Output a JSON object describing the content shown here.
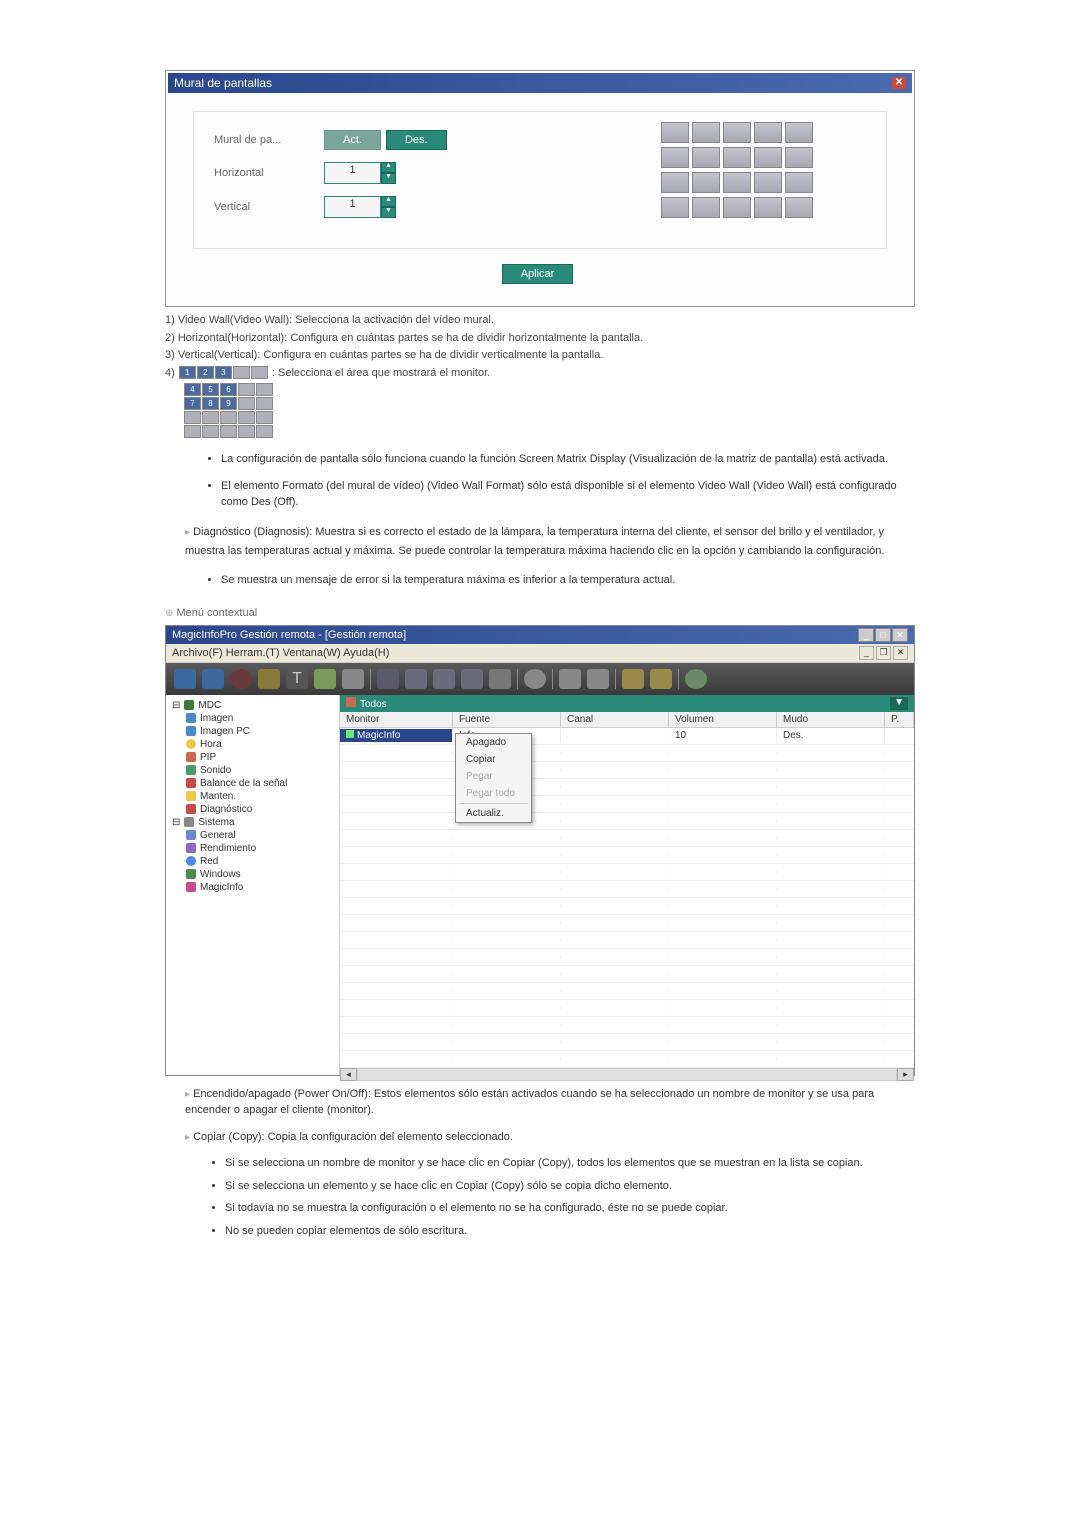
{
  "dialog": {
    "title": "Mural de pantallas",
    "labels": {
      "mural": "Mural de pa...",
      "horizontal": "Horizontal",
      "vertical": "Vertical"
    },
    "buttons": {
      "act": "Act.",
      "des": "Des.",
      "aplicar": "Aplicar"
    },
    "values": {
      "horizontal": "1",
      "vertical": "1"
    }
  },
  "desc": {
    "d1": "1) Video Wall(Video Wall): Selecciona la activación del vídeo mural.",
    "d2": "2) Horizontal(Horizontal): Configura en cuántas partes se ha de dividir horizontalmente la pantalla.",
    "d3": "3) Vertical(Vertical): Configura en cuántas partes se ha de dividir verticalmente la pantalla.",
    "d4_pre": "4) ",
    "d4_post": " : Selecciona el área que mostrará el monitor."
  },
  "bullets1": {
    "b1": "La configuración de pantalla sólo funciona cuando la función Screen Matrix Display (Visualización de la matriz de pantalla) está activada.",
    "b2": "El elemento Formato (del mural de vídeo) (Video Wall Format) sólo está disponible si el elemento Video Wall (Video Wall) está configurado como Des (Off)."
  },
  "diag_para": "Diagnóstico (Diagnosis): Muestra si es correcto el estado de la lámpara, la temperatura interna del cliente, el sensor del brillo y el ventilador, y muestra las temperaturas actual y máxima. Se puede controlar la temperatura máxima haciendo clic en la opción y cambiando la configuración.",
  "diag_bullet": "Se muestra un mensaje de error si la temperatura máxima es inferior a la temperatura actual.",
  "menu_contextual_heading": "Menú contextual",
  "app": {
    "title": "MagicInfoPro Gestión remota - [Gestión remota]",
    "menubar": "Archivo(F)  Herram.(T)  Ventana(W)  Ayuda(H)",
    "tree": {
      "root": "MDC",
      "imagen": "Imagen",
      "imagen_pc": "Imagen PC",
      "hora": "Hora",
      "pip": "PIP",
      "sonido": "Sonido",
      "balance": "Balance de la señal",
      "manten": "Manten.",
      "diagnostico": "Diagnóstico",
      "sistema": "Sistema",
      "general": "General",
      "rendimiento": "Rendimiento",
      "red": "Red",
      "windows": "Windows",
      "magicinfo": "MagicInfo"
    },
    "right_top": "Todos",
    "headers": {
      "monitor": "Monitor",
      "fuente": "Fuente",
      "canal": "Canal",
      "volumen": "Volumen",
      "mudo": "Mudo",
      "p": "P."
    },
    "row1": {
      "monitor": "MagicInfo",
      "fuente": "Info",
      "volumen": "10",
      "mudo": "Des."
    },
    "context": {
      "apagado": "Apagado",
      "copiar": "Copiar",
      "pegar": "Pegar",
      "pegar_todo": "Pegar todo",
      "actualiz": "Actualiz."
    }
  },
  "after1": "Encendido/apagado (Power On/Off): Estos elementos sólo están activados cuando se ha seleccionado un nombre de monitor y se usa para encender o apagar el cliente (monitor).",
  "after2": "Copiar (Copy): Copia la configuración del elemento seleccionado.",
  "bullets2": {
    "b1": "Si se selecciona un nombre de monitor y se hace clic en Copiar (Copy), todos los elementos que se muestran en la lista se copian.",
    "b2": "Si se selecciona un elemento y se hace clic en Copiar (Copy) sólo se copia dicho elemento.",
    "b3": "Si todavía no se muestra la configuración o el elemento no se ha configurado, éste no se puede copiar.",
    "b4": "No se pueden copiar elementos de sólo escritura."
  }
}
